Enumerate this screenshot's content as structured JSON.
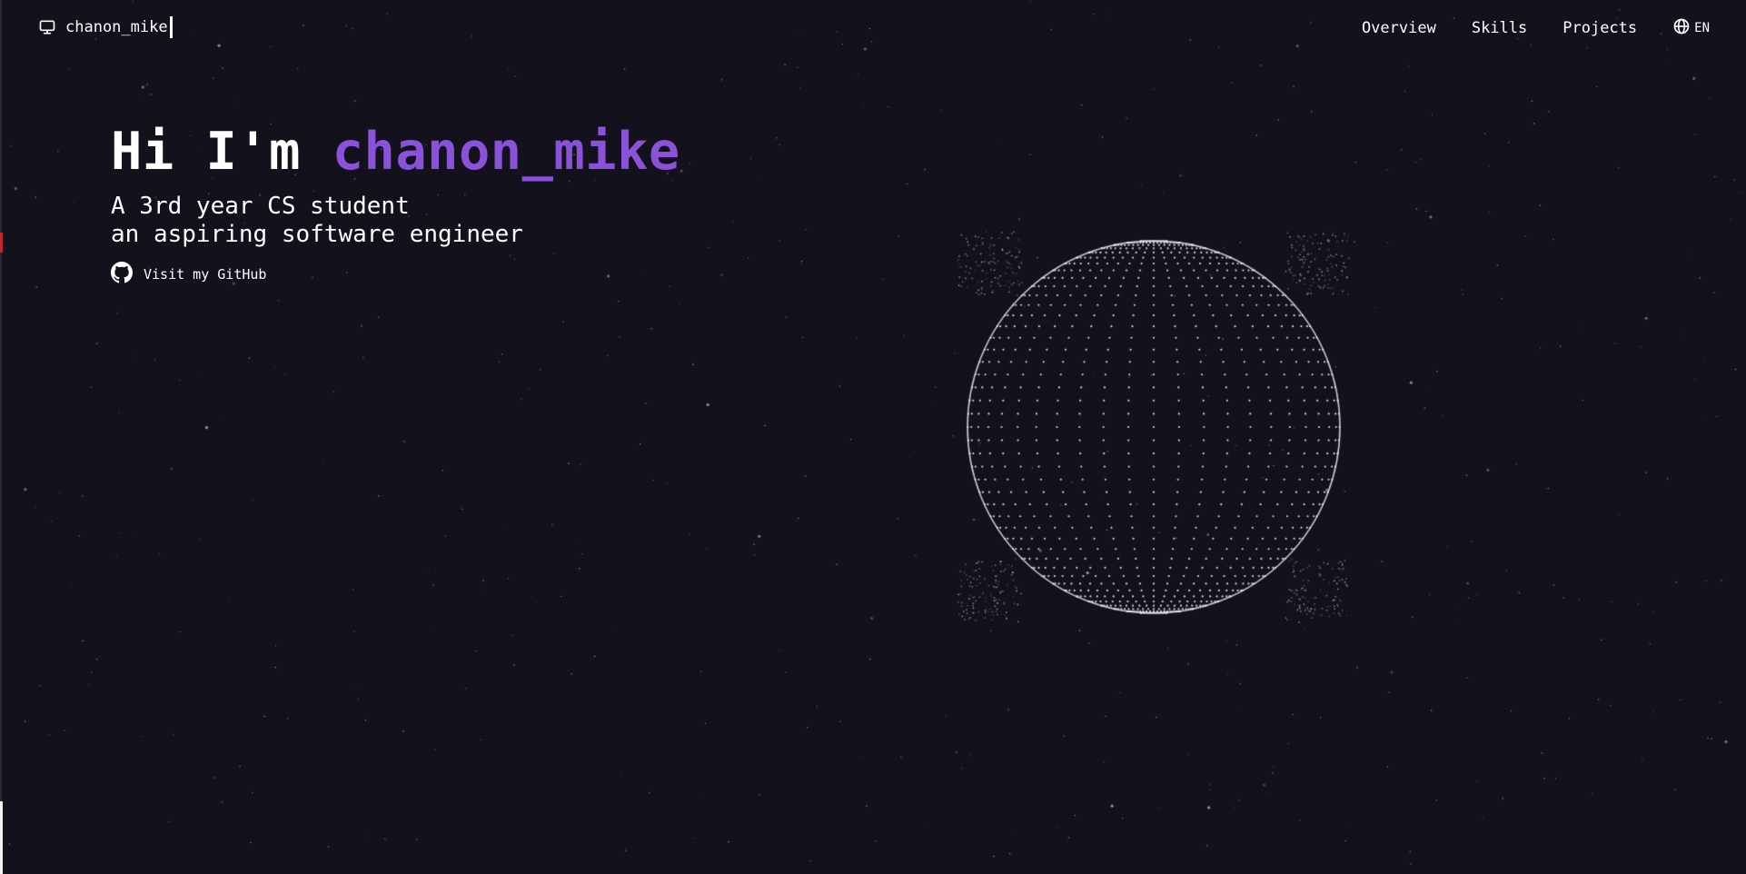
{
  "navbar": {
    "brand_name": "chanon_mike",
    "links": [
      {
        "label": "Overview"
      },
      {
        "label": "Skills"
      },
      {
        "label": "Projects"
      }
    ],
    "language": "EN",
    "brand_icon": "monitor-icon",
    "language_icon": "globe-icon"
  },
  "hero": {
    "greeting": "Hi I'm ",
    "name": "chanon_mike",
    "line1": "A 3rd year CS student",
    "line2": "an aspiring software engineer",
    "github_label": "Visit my GitHub",
    "github_icon": "github-icon"
  },
  "colors": {
    "background": "#12111c",
    "accent": "#8a52d8",
    "text": "#ffffff"
  }
}
